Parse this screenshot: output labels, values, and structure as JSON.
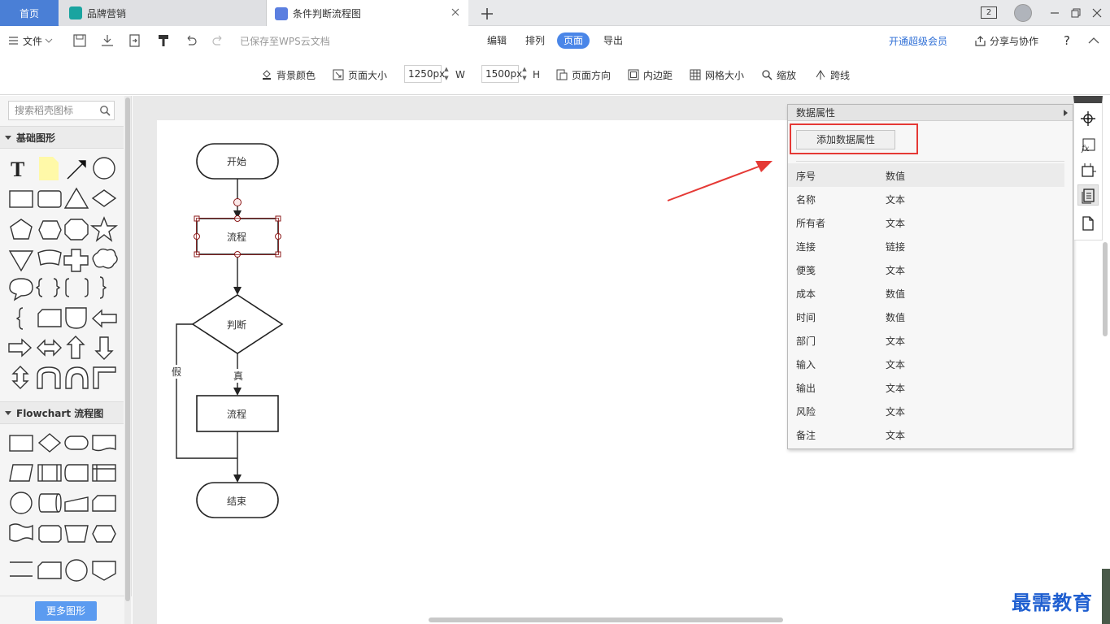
{
  "tabs": {
    "home": "首页",
    "brand": "品牌营销",
    "active": "条件判断流程图",
    "badge": "2"
  },
  "toolbar": {
    "file": "文件",
    "saved": "已保存至WPS云文档",
    "menu": [
      "编辑",
      "排列",
      "页面",
      "导出"
    ],
    "active_menu": "页面",
    "vip": "开通超级会员",
    "share": "分享与协作",
    "help": "?"
  },
  "page_toolbar": {
    "bg_color": "背景颜色",
    "page_size": "页面大小",
    "width_value": "1250px",
    "width_label": "W",
    "height_value": "1500px",
    "height_label": "H",
    "orientation": "页面方向",
    "padding": "内边距",
    "grid": "网格大小",
    "zoom": "缩放",
    "cross": "跨线"
  },
  "left_panel": {
    "search_placeholder": "搜索稻壳图标",
    "section_basic": "基础图形",
    "section_flowchart": "Flowchart 流程图",
    "more_shapes": "更多图形"
  },
  "flowchart": {
    "start": "开始",
    "process1": "流程",
    "decision": "判断",
    "true_label": "真",
    "false_label": "假",
    "process2": "流程",
    "end": "结束"
  },
  "data_panel": {
    "title": "数据属性",
    "add_button": "添加数据属性",
    "header": {
      "key": "序号",
      "value": "数值"
    },
    "rows": [
      {
        "key": "名称",
        "value": "文本"
      },
      {
        "key": "所有者",
        "value": "文本"
      },
      {
        "key": "连接",
        "value": "链接"
      },
      {
        "key": "便笺",
        "value": "文本"
      },
      {
        "key": "成本",
        "value": "数值"
      },
      {
        "key": "时间",
        "value": "数值"
      },
      {
        "key": "部门",
        "value": "文本"
      },
      {
        "key": "输入",
        "value": "文本"
      },
      {
        "key": "输出",
        "value": "文本"
      },
      {
        "key": "风险",
        "value": "文本"
      },
      {
        "key": "备注",
        "value": "文本"
      }
    ]
  },
  "watermark": "最需教育",
  "colors": {
    "accent": "#4a86e8",
    "home_tab": "#4a7fd6",
    "highlight": "#e53935",
    "vip": "#2f6fd6"
  }
}
